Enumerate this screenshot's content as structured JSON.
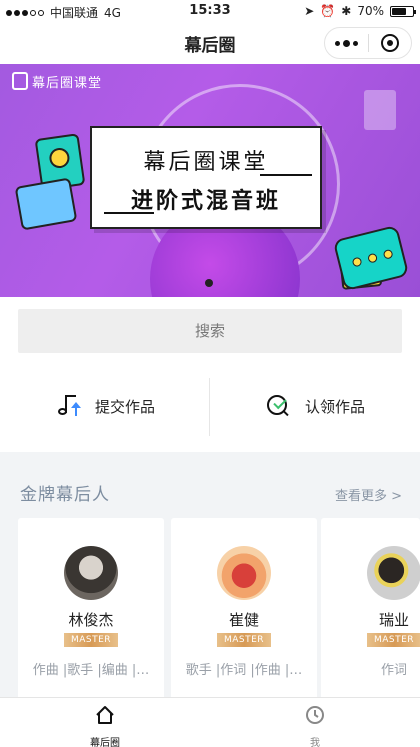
{
  "status_bar": {
    "carrier": "中国联通",
    "network": "4G",
    "time": "15:33",
    "battery": "70%",
    "battery_level": 0.7
  },
  "navbar": {
    "title": "幕后圈"
  },
  "banner": {
    "logo_name": "幕后圈课堂",
    "line1": "幕后圈课堂",
    "line2": "进阶式混音班",
    "slide_count": 1,
    "active_slide": 1
  },
  "search": {
    "placeholder": "搜索"
  },
  "actions": {
    "submit_label": "提交作品",
    "claim_label": "认领作品"
  },
  "gold_section": {
    "title": "金牌幕后人",
    "more_label": "查看更多 >",
    "people": [
      {
        "name": "林俊杰",
        "badge": "MASTER",
        "tags": "作曲 |歌手 |编曲 |…"
      },
      {
        "name": "崔健",
        "badge": "MASTER",
        "tags": "歌手 |作词 |作曲 |…"
      },
      {
        "name": "瑞业",
        "badge": "MASTER",
        "tags": "作词"
      }
    ]
  },
  "tabbar": {
    "tabs": [
      {
        "label": "幕后圈",
        "icon": "home-icon",
        "active": true
      },
      {
        "label": "我",
        "icon": "clock-icon",
        "active": false
      }
    ]
  },
  "colors": {
    "banner_purple": "#a35ae0",
    "section_bg": "#f2f4f6",
    "badge_gold": "#d79a55",
    "accent_blue": "#3d8bfd",
    "accent_green": "#3cbf6d"
  }
}
